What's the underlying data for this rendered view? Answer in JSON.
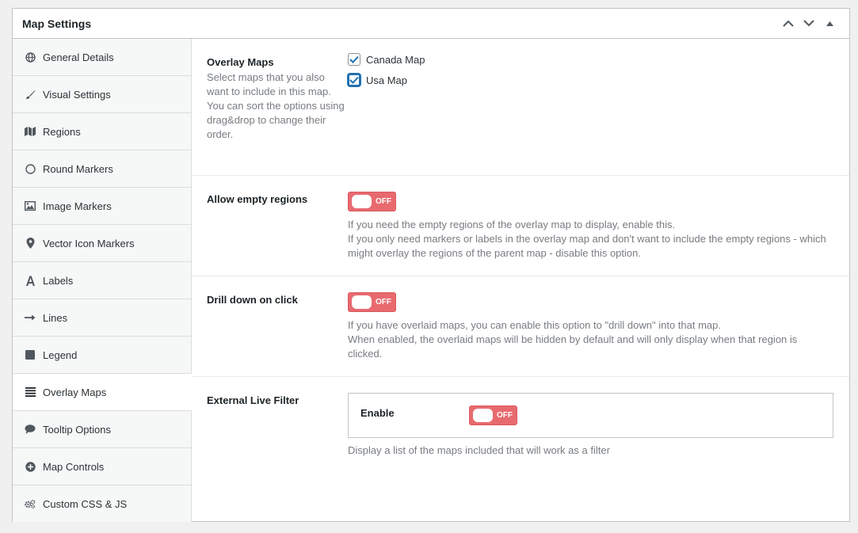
{
  "postbox": {
    "title": "Map Settings"
  },
  "sidebar": {
    "items": [
      {
        "label": "General Details",
        "icon": "globe-icon"
      },
      {
        "label": "Visual Settings",
        "icon": "brush-icon"
      },
      {
        "label": "Regions",
        "icon": "map-icon"
      },
      {
        "label": "Round Markers",
        "icon": "circle-icon"
      },
      {
        "label": "Image Markers",
        "icon": "image-icon"
      },
      {
        "label": "Vector Icon Markers",
        "icon": "location-pin-icon"
      },
      {
        "label": "Labels",
        "icon": "letter-a-icon"
      },
      {
        "label": "Lines",
        "icon": "arrow-right-icon"
      },
      {
        "label": "Legend",
        "icon": "square-icon"
      },
      {
        "label": "Overlay Maps",
        "icon": "list-icon",
        "active": true
      },
      {
        "label": "Tooltip Options",
        "icon": "speech-bubble-icon"
      },
      {
        "label": "Map Controls",
        "icon": "plus-circle-icon"
      },
      {
        "label": "Custom CSS & JS",
        "icon": "gears-icon"
      }
    ]
  },
  "overlay": {
    "title": "Overlay Maps",
    "desc1": "Select maps that you also want to include in this map.",
    "desc2": "You can sort the options using drag&drop to change their order.",
    "options": [
      {
        "label": "Canada Map",
        "checked": true
      },
      {
        "label": "Usa Map",
        "checked": true
      }
    ]
  },
  "empty_regions": {
    "title": "Allow empty regions",
    "toggle": "OFF",
    "desc1": "If you need the empty regions of the overlay map to display, enable this.",
    "desc2": "If you only need markers or labels in the overlay map and don't want to include the empty regions - which might overlay the regions of the parent map - disable this option."
  },
  "drill_down": {
    "title": "Drill down on click",
    "toggle": "OFF",
    "desc1": "If you have overlaid maps, you can enable this option to \"drill down\" into that map.",
    "desc2": "When enabled, the overlaid maps will be hidden by default and will only display when that region is clicked."
  },
  "live_filter": {
    "title": "External Live Filter",
    "enable_label": "Enable",
    "toggle": "OFF",
    "desc": "Display a list of the maps included that will work as a filter"
  },
  "colors": {
    "toggle_off": "#e86a6f",
    "accent": "#2271b1",
    "muted_text": "#787c82"
  }
}
